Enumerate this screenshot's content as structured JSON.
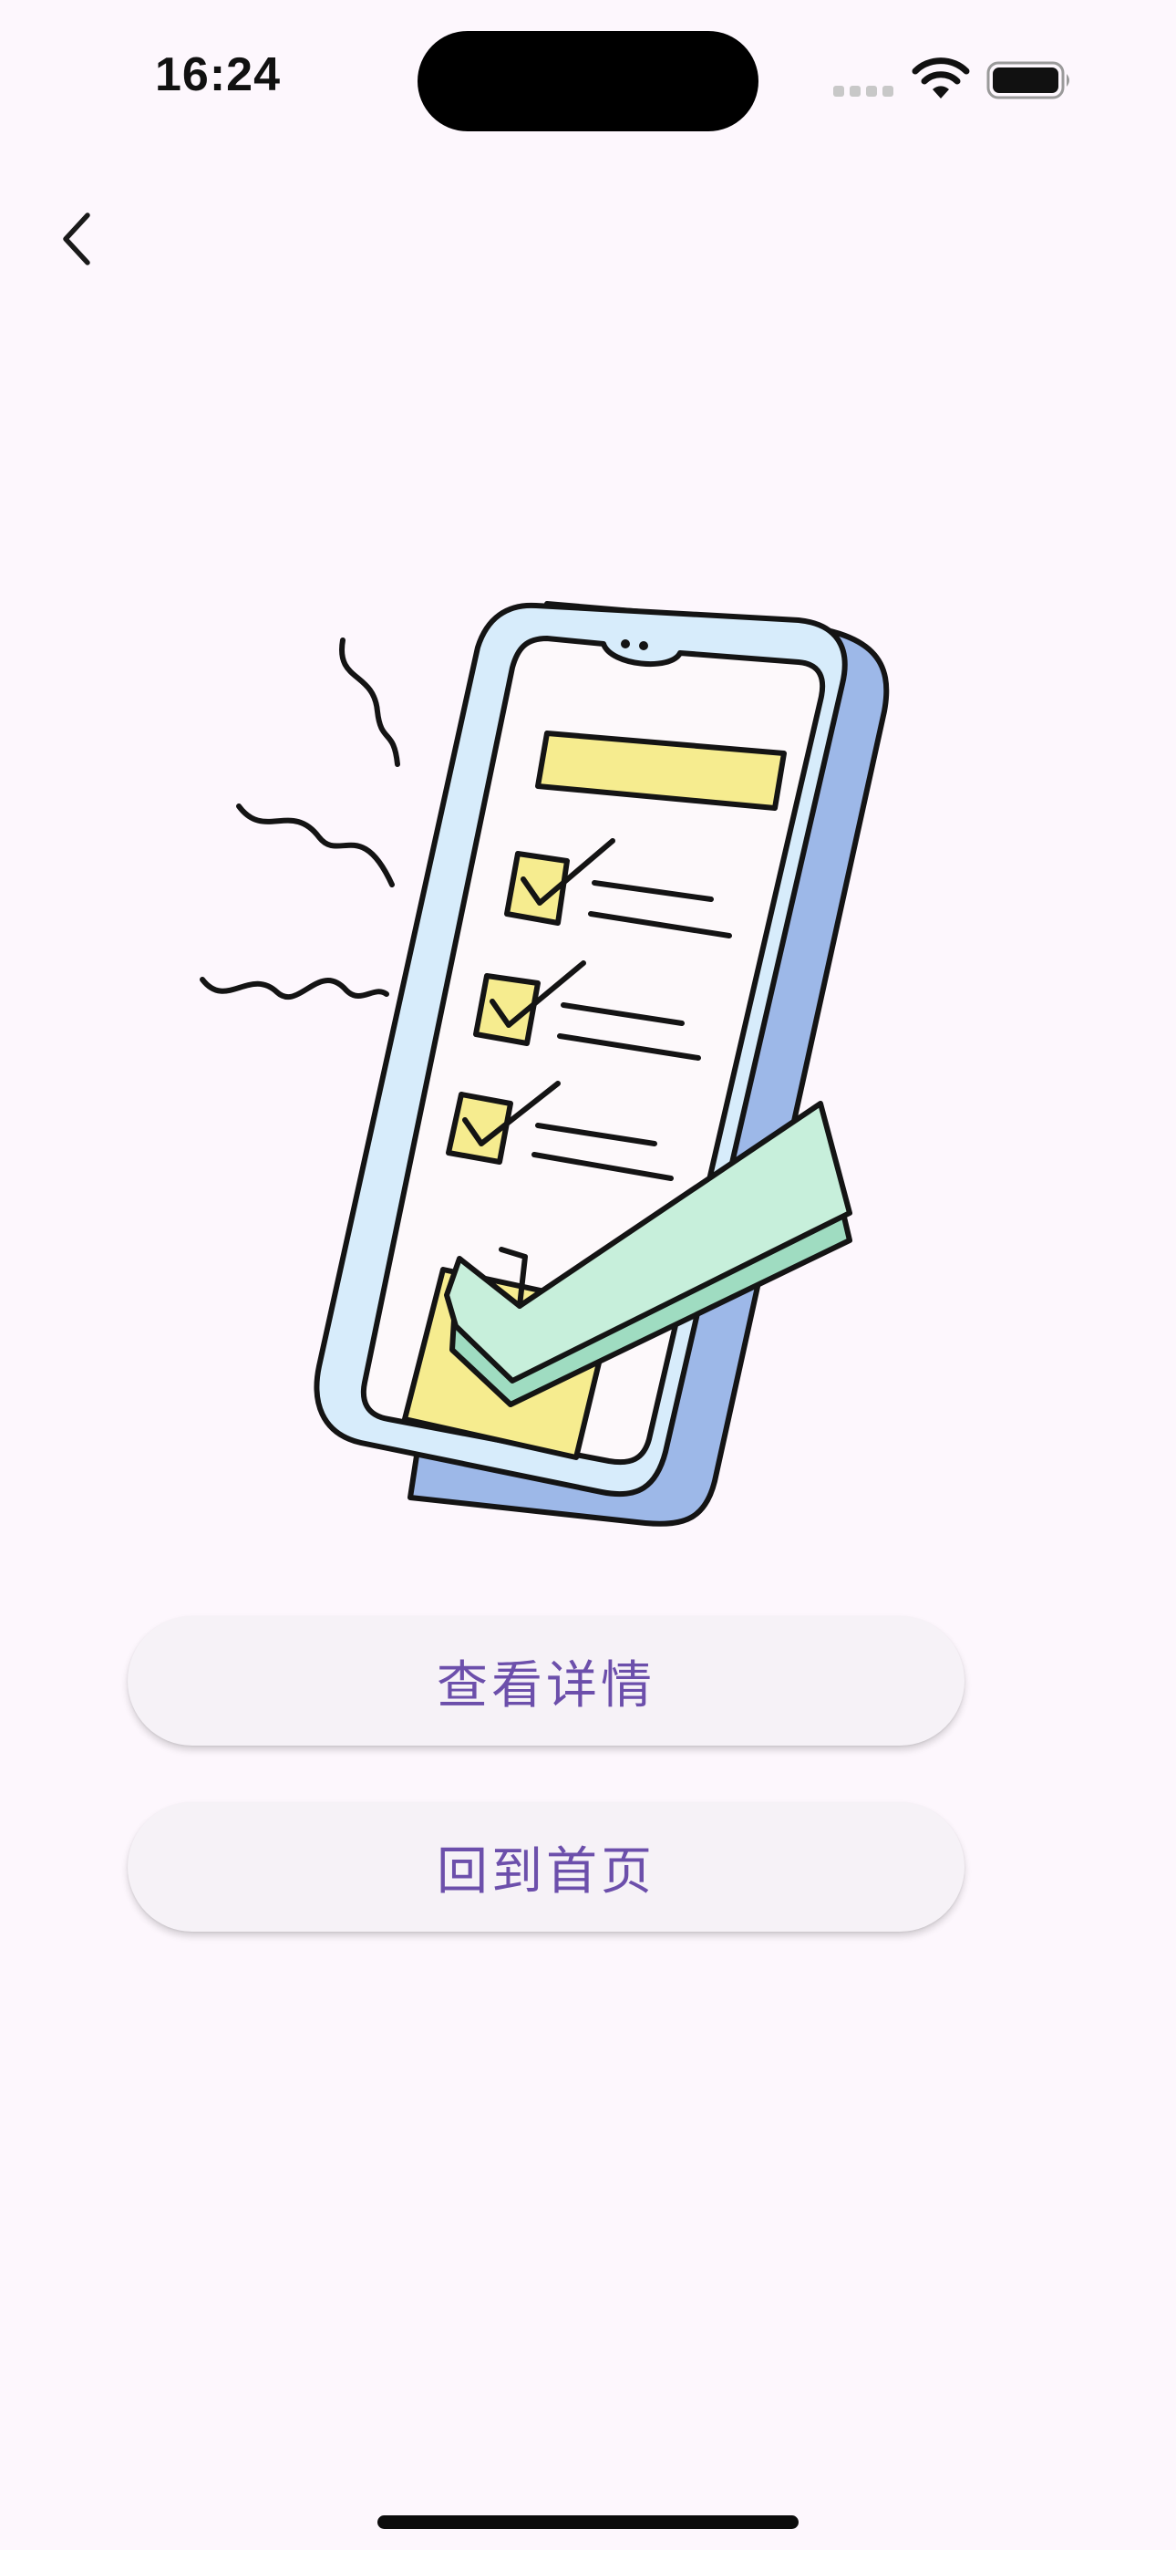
{
  "status_bar": {
    "time": "16:24"
  },
  "nav": {
    "back_icon": "chevron-left-icon"
  },
  "illustration": {
    "icon": "phone-checklist-illustration",
    "colors": {
      "phone_frame": "#d7ecfb",
      "phone_side": "#9db8e8",
      "screen": "#fdf9fb",
      "yellow": "#f6ec8f",
      "mint": "#c7efdb",
      "outline": "#141414"
    }
  },
  "actions": {
    "view_details_label": "查看详情",
    "back_home_label": "回到首页"
  },
  "theme": {
    "background": "#fdf7fd",
    "accent": "#6c4fab",
    "button_bg": "#f6f2f7"
  }
}
